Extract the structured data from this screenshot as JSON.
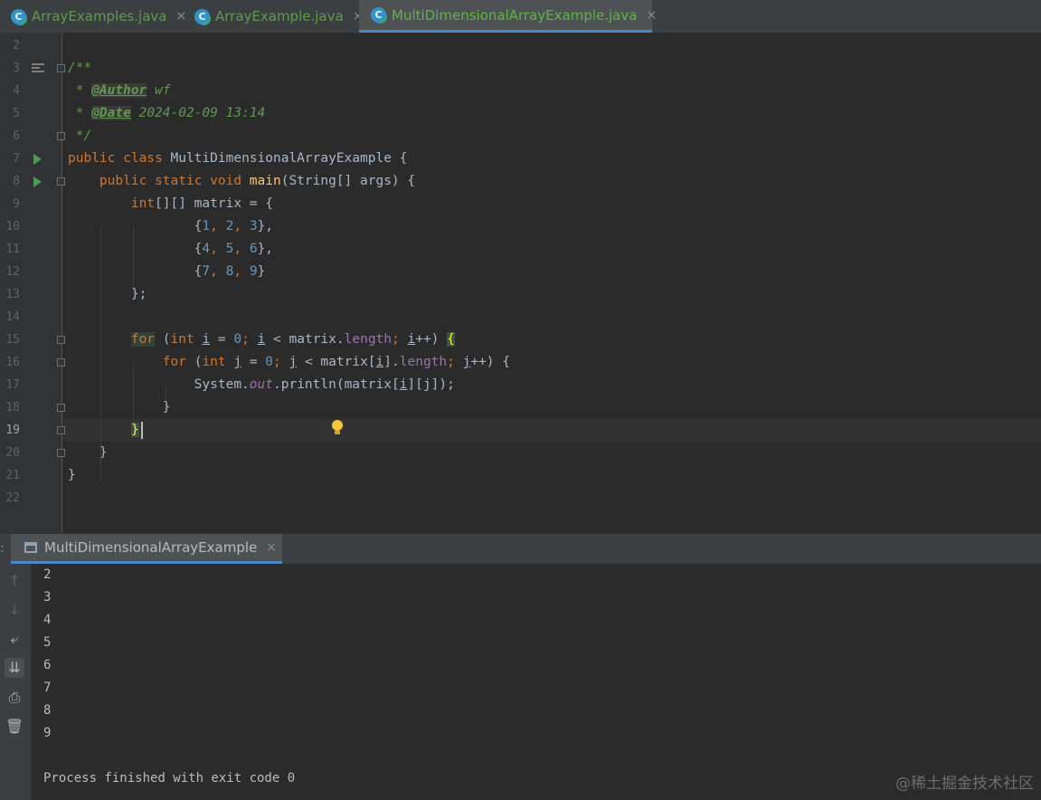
{
  "tabs": [
    {
      "label": "ArrayExamples.java",
      "active": false
    },
    {
      "label": "ArrayExample.java",
      "active": false
    },
    {
      "label": "MultiDimensionalArrayExample.java",
      "active": true
    }
  ],
  "icons": {
    "close": "×",
    "class_letter": "C"
  },
  "editor": {
    "current_line": 19,
    "line_numbers": [
      "2",
      "3",
      "4",
      "5",
      "6",
      "7",
      "8",
      "9",
      "10",
      "11",
      "12",
      "13",
      "14",
      "15",
      "16",
      "17",
      "18",
      "19",
      "20",
      "21",
      "22"
    ],
    "code": {
      "l3": "/**",
      "l4_star": " * ",
      "l4_tag": "@Author",
      "l4_val": " wf",
      "l5_star": " * ",
      "l5_tag": "@Date",
      "l5_val": " 2024-02-09 13:14",
      "l6": " */",
      "l7_kw": "public class",
      "l7_rest": " MultiDimensionalArrayExample {",
      "l8_kw": "    public static void",
      "l8_fn": "main",
      "l8_rest": "(String[] args) {",
      "l9_kw": "        int",
      "l9_rest": "[][] matrix = {",
      "l13": "        };",
      "l15_kw": "for",
      "l16_kw": "for",
      "l17_a": "                System.",
      "l17_out": "out",
      "l17_b": ".println(matrix[",
      "l17_i": "i",
      "l17_c": "][j]);",
      "l18": "            }",
      "l19": "}",
      "l20": "    }",
      "l21": "}"
    },
    "rows": [
      {
        "open": "                {",
        "a": "1",
        "b": "2",
        "c": "3",
        "close": "},"
      },
      {
        "open": "                {",
        "a": "4",
        "b": "5",
        "c": "6",
        "close": "},"
      },
      {
        "open": "                {",
        "a": "7",
        "b": "8",
        "c": "9",
        "close": "}"
      }
    ]
  },
  "run_panel": {
    "tab_label": "MultiDimensionalArrayExample",
    "output_lines": [
      "2",
      "3",
      "4",
      "5",
      "6",
      "7",
      "8",
      "9"
    ],
    "exit_message": "Process finished with exit code 0"
  },
  "watermark": "@稀土掘金技术社区"
}
